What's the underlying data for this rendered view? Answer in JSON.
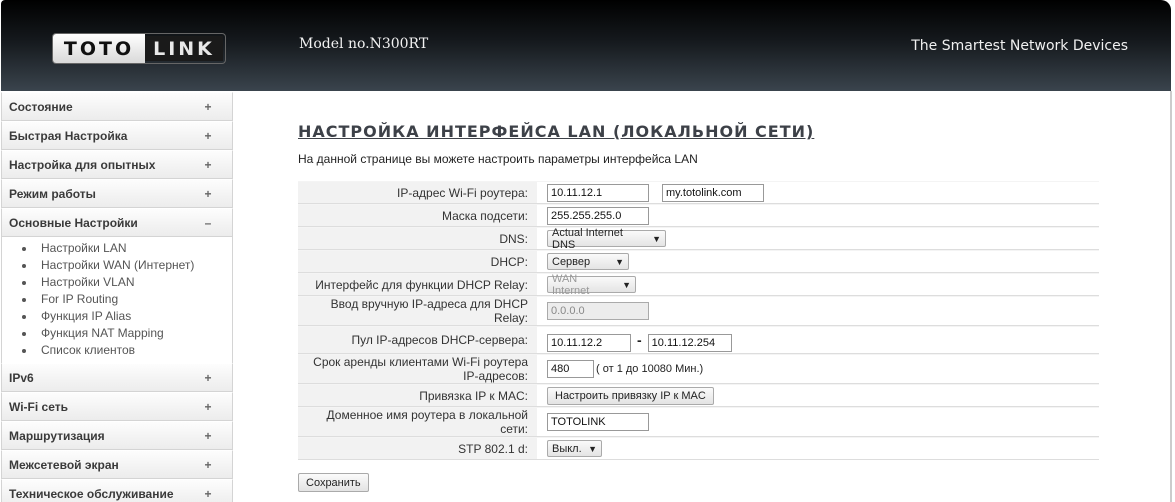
{
  "header": {
    "logo_left": "TOTO",
    "logo_right": "LINK",
    "model": "Model no.N300RT",
    "slogan": "The Smartest Network Devices"
  },
  "sidebar": {
    "items": [
      {
        "label": "Состояние",
        "sign": "+"
      },
      {
        "label": "Быстрая Настройка",
        "sign": "+"
      },
      {
        "label": "Настройка для опытных",
        "sign": "+"
      },
      {
        "label": "Режим работы",
        "sign": "+"
      },
      {
        "label": "Основные Настройки",
        "sign": "–",
        "expanded": true
      },
      {
        "label": "IPv6",
        "sign": "+"
      },
      {
        "label": "Wi-Fi сеть",
        "sign": "+"
      },
      {
        "label": "Маршрутизация",
        "sign": "+"
      },
      {
        "label": "Межсетевой экран",
        "sign": "+"
      },
      {
        "label": "Техническое обслуживание",
        "sign": "+"
      }
    ],
    "submenu": [
      "Настройки LAN",
      "Настройки WAN (Интернет)",
      "Настройки VLAN",
      "For IP Routing",
      "Функция IP Alias",
      "Функция NAT Mapping",
      "Список клиентов"
    ]
  },
  "main": {
    "title": "НАСТРОЙКА ИНТЕРФЕЙСА LAN (ЛОКАЛЬНОЙ СЕТИ)",
    "description": "На данной странице вы можете настроить параметры интерфейса LAN",
    "fields": {
      "ip_label": "IP-адрес Wi-Fi роутера:",
      "ip_value": "10.11.12.1",
      "domain_value": "my.totolink.com",
      "mask_label": "Маска подсети:",
      "mask_value": "255.255.255.0",
      "dns_label": "DNS:",
      "dns_value": "Actual Internet DNS",
      "dhcp_label": "DHCP:",
      "dhcp_value": "Сервер",
      "relay_if_label": "Интерфейс для функции DHCP Relay:",
      "relay_if_value": "WAN Internet",
      "relay_ip_label": "Ввод вручную IP-адреса для DHCP Relay:",
      "relay_ip_value": "0.0.0.0",
      "pool_label": "Пул IP-адресов DHCP-сервера:",
      "pool_start": "10.11.12.2",
      "pool_sep": "-",
      "pool_end": "10.11.12.254",
      "lease_label": "Срок аренды клиентами Wi-Fi роутера IP-адресов:",
      "lease_value": "480",
      "lease_hint": "( от 1 до 10080 Мин.)",
      "mac_label": "Привязка IP к MAC:",
      "mac_button": "Настроить привязку IP к MAC",
      "hostname_label": "Доменное имя роутера в локальной сети:",
      "hostname_value": "TOTOLINK",
      "stp_label": "STP 802.1 d:",
      "stp_value": "Выкл."
    },
    "save_label": "Сохранить"
  }
}
